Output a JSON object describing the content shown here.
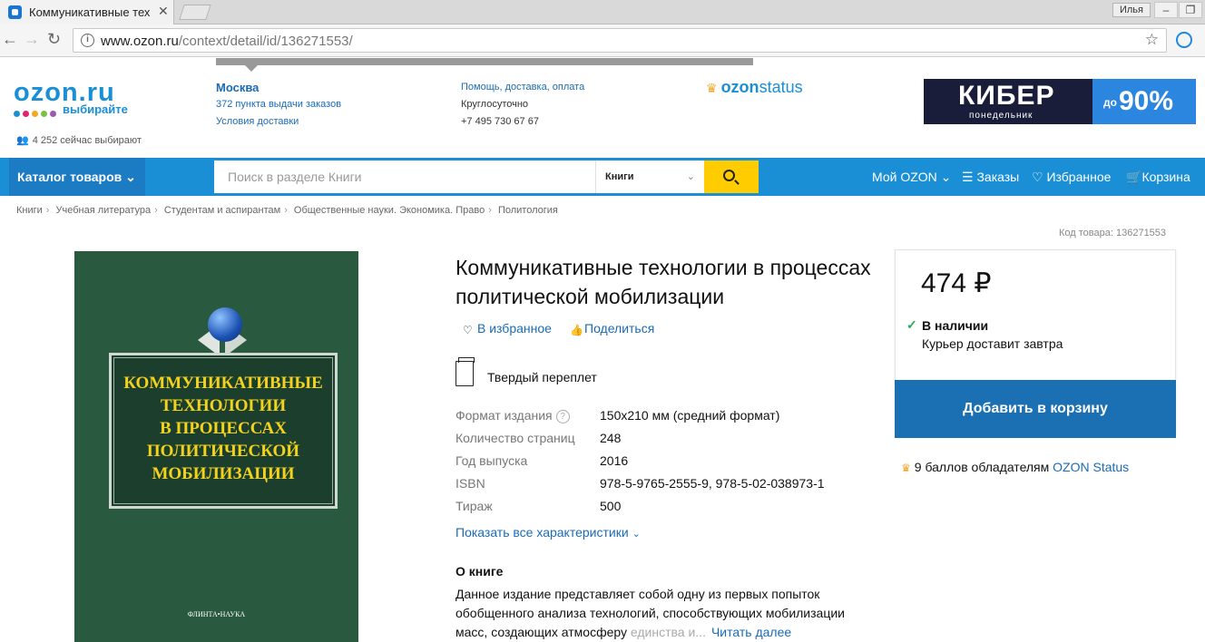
{
  "browser": {
    "tab_title": "Коммуникативные тех",
    "user_name": "Илья",
    "url_host": "www.ozon.ru",
    "url_path": "/context/detail/id/136271553/"
  },
  "header": {
    "logo_text": "ozon.ru",
    "slogan": "выбирайте",
    "choosing_now": "4 252 сейчас выбирают",
    "city": "Москва",
    "pickup_points": "372 пункта выдачи заказов",
    "delivery_terms": "Условия доставки",
    "help": "Помощь, доставка, оплата",
    "around_clock": "Круглосуточно",
    "phone": "+7 495 730 67 67",
    "status_logo_bold": "ozon",
    "status_logo_rest": "status",
    "banner_title": "КИБЕР",
    "banner_subtitle": "понедельник",
    "banner_up_to": "до",
    "banner_discount": "90%"
  },
  "nav": {
    "catalog": "Каталог товаров",
    "search_placeholder": "Поиск в разделе Книги",
    "search_section": "Книги",
    "my_ozon": "Мой OZON",
    "orders": "Заказы",
    "favorites": "Избранное",
    "cart": "Корзина"
  },
  "breadcrumbs": [
    "Книги",
    "Учебная литература",
    "Студентам и аспирантам",
    "Общественные науки. Экономика. Право",
    "Политология"
  ],
  "product": {
    "code": "Код товара: 136271553",
    "title": "Коммуникативные технологии в процессах политической мобилизации",
    "add_favorite": "В избранное",
    "share": "Поделиться",
    "binding": "Твердый переплет",
    "cover_title_lines": [
      "КОММУНИКАТИВНЫЕ",
      "ТЕХНОЛОГИИ",
      "В ПРОЦЕССАХ",
      "ПОЛИТИЧЕСКОЙ",
      "МОБИЛИЗАЦИИ"
    ],
    "cover_publisher": "ФЛИНТА•НАУКА",
    "specs": [
      {
        "key": "Формат издания",
        "value": "150x210 мм (средний формат)"
      },
      {
        "key": "Количество страниц",
        "value": "248"
      },
      {
        "key": "Год выпуска",
        "value": "2016"
      },
      {
        "key": "ISBN",
        "value": "978-5-9765-2555-9, 978-5-02-038973-1"
      },
      {
        "key": "Тираж",
        "value": "500"
      }
    ],
    "show_all": "Показать все характеристики",
    "about_heading": "О книге",
    "about_text": "Данное издание представляет собой одну из первых попыток обобщенного анализа технологий, способствующих мобилизации масс, создающих атмосферу",
    "about_fade": "единства и...",
    "read_more": "Читать далее"
  },
  "buy": {
    "price": "474 ₽",
    "in_stock": "В наличии",
    "delivery": "Курьер доставит завтра",
    "add_to_cart": "Добавить в корзину",
    "points_text": "9 баллов обладателям",
    "points_link": "OZON Status"
  },
  "colors": {
    "brand_blue": "#1a8fd6",
    "button_blue": "#1a70b3",
    "search_yellow": "#ffcc00",
    "cover_green": "#295a3f",
    "cover_title": "#f3d21c"
  }
}
